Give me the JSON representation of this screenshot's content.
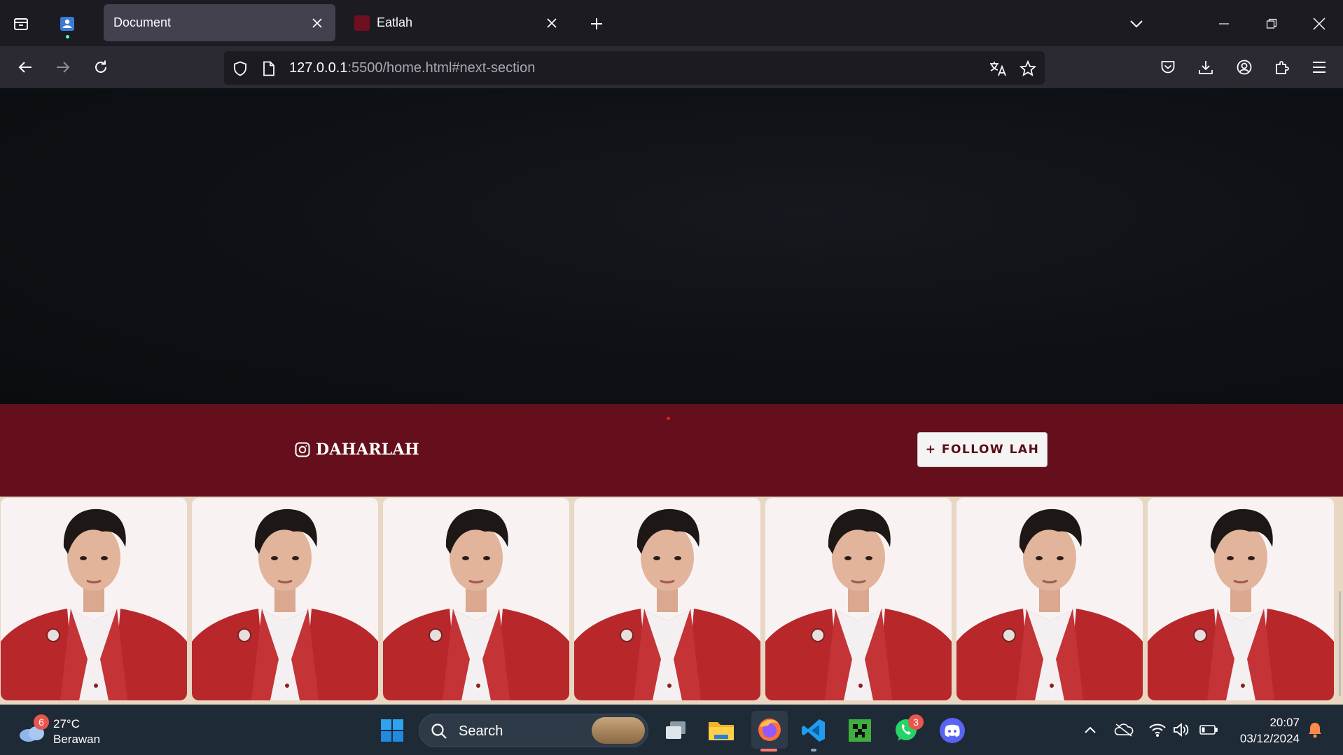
{
  "browser": {
    "tabs": [
      {
        "title": "Document",
        "active": true
      },
      {
        "title": "Eatlah",
        "active": false
      }
    ],
    "url": {
      "host": "127.0.0.1",
      "rest": ":5500/home.html#next-section"
    }
  },
  "page": {
    "instagram_handle": "DAHARLAH",
    "follow_button": "+ FOLLOW LAH",
    "photo_count": 7,
    "colors": {
      "banner": "#640f1b",
      "gallery_bg": "#e8d7c3",
      "hero": "#0d1115"
    }
  },
  "taskbar": {
    "weather": {
      "temp": "27°C",
      "desc": "Berawan",
      "badge": "6"
    },
    "search_label": "Search",
    "whatsapp_badge": "3",
    "clock": {
      "time": "20:07",
      "date": "03/12/2024"
    }
  }
}
